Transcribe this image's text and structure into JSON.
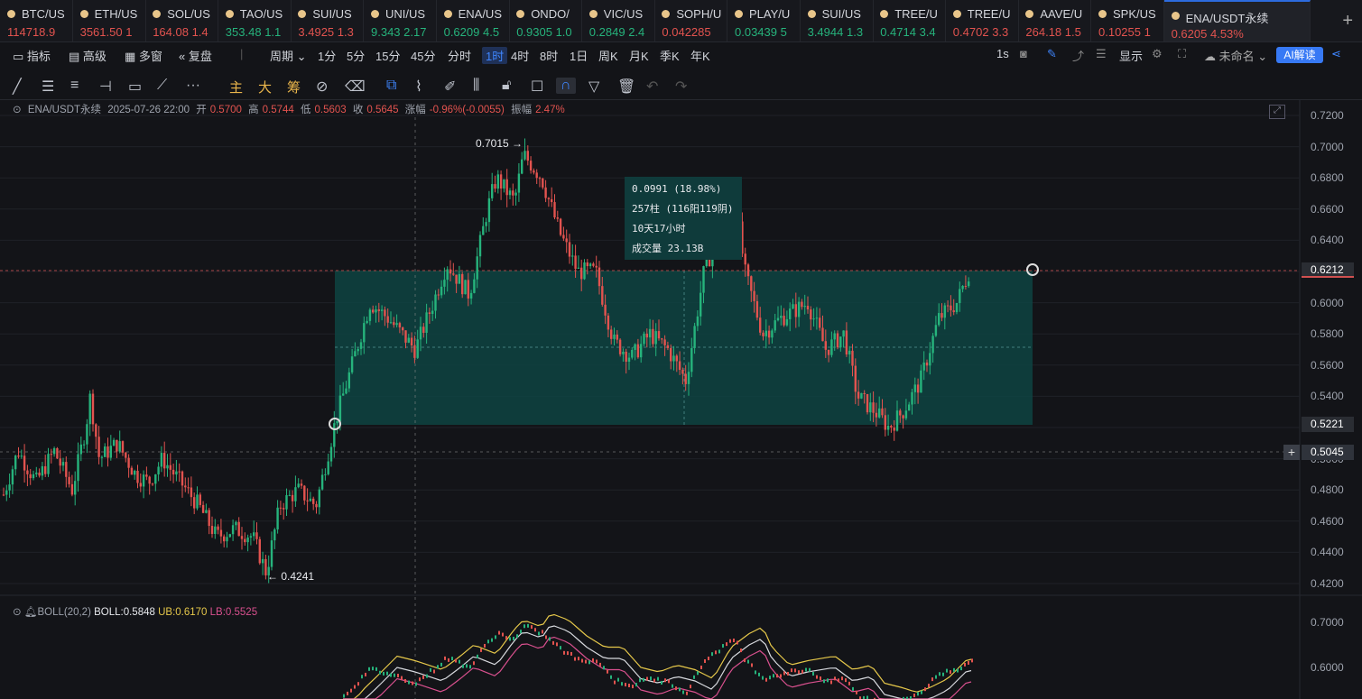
{
  "tickers": [
    {
      "symbol": "BTC/US",
      "price": "114718.9",
      "chg": "",
      "dir": "dn"
    },
    {
      "symbol": "ETH/US",
      "price": "3561.50",
      "chg": "1",
      "dir": "dn"
    },
    {
      "symbol": "SOL/US",
      "price": "164.08",
      "chg": "1.4",
      "dir": "dn"
    },
    {
      "symbol": "TAO/US",
      "price": "353.48",
      "chg": "1.1",
      "dir": "up"
    },
    {
      "symbol": "SUI/US",
      "price": "3.4925",
      "chg": "1.3",
      "dir": "dn"
    },
    {
      "symbol": "UNI/US",
      "price": "9.343",
      "chg": "2.17",
      "dir": "up"
    },
    {
      "symbol": "ENA/US",
      "price": "0.6209",
      "chg": "4.5",
      "dir": "up"
    },
    {
      "symbol": "ONDO/",
      "price": "0.9305",
      "chg": "1.0",
      "dir": "up"
    },
    {
      "symbol": "VIC/US",
      "price": "0.2849",
      "chg": "2.4",
      "dir": "up"
    },
    {
      "symbol": "SOPH/U",
      "price": "0.042285",
      "chg": "",
      "dir": "dn"
    },
    {
      "symbol": "PLAY/U",
      "price": "0.03439",
      "chg": "5",
      "dir": "up"
    },
    {
      "symbol": "SUI/US",
      "price": "3.4944",
      "chg": "1.3",
      "dir": "up"
    },
    {
      "symbol": "TREE/U",
      "price": "0.4714",
      "chg": "3.4",
      "dir": "up"
    },
    {
      "symbol": "TREE/U",
      "price": "0.4702",
      "chg": "3.3",
      "dir": "dn"
    },
    {
      "symbol": "AAVE/U",
      "price": "264.18",
      "chg": "1.5",
      "dir": "dn"
    },
    {
      "symbol": "SPK/US",
      "price": "0.10255",
      "chg": "1",
      "dir": "dn"
    },
    {
      "symbol": "ENA/USDT永续",
      "price": "0.6205",
      "chg": "4.53%",
      "dir": "dn",
      "active": true
    }
  ],
  "toolbar1": {
    "indicators": "指标",
    "advanced": "高级",
    "multiwindow": "多窗",
    "replay": "复盘",
    "period": "周期",
    "intervals": [
      "1分",
      "5分",
      "15分",
      "45分",
      "分时",
      "1时",
      "4时",
      "8时",
      "1日",
      "周K",
      "月K",
      "季K",
      "年K"
    ],
    "selected_interval": "1时",
    "right_interval": "1s",
    "display": "显示",
    "layout_name": "未命名",
    "ai_button": "AI解读"
  },
  "toolbar2": {
    "main": "主",
    "big": "大",
    "chips": "筹"
  },
  "info": {
    "symbol": "ENA/USDT永续",
    "datetime": "2025-07-26 22:00",
    "open_label": "开",
    "open": "0.5700",
    "high_label": "高",
    "high": "0.5744",
    "low_label": "低",
    "low": "0.5603",
    "close_label": "收",
    "close": "0.5645",
    "change_label": "涨幅",
    "change": "-0.96%(-0.0055)",
    "amp_label": "振幅",
    "amp": "2.47%"
  },
  "boll": {
    "label": "BOLL(20,2)",
    "mid": "BOLL:0.5848",
    "ub": "UB:0.6170",
    "lb": "LB:0.5525"
  },
  "measure": {
    "line1": "0.0991 (18.98%)",
    "line2": "257柱 (116阳119阴)",
    "line3": "10天17小时",
    "line4": "成交量 23.13B"
  },
  "annotations": {
    "high": "0.7015",
    "low": "0.4241"
  },
  "price_tags": {
    "current": "0.6212",
    "range_low": "0.5221",
    "crosshair": "0.5045"
  },
  "chart_data": {
    "type": "candlestick",
    "ylim": [
      0.41,
      0.725
    ],
    "yticks": [
      "0.7200",
      "0.7000",
      "0.6800",
      "0.6600",
      "0.6400",
      "0.6200",
      "0.6000",
      "0.5800",
      "0.5600",
      "0.5400",
      "0.5200",
      "0.5000",
      "0.4800",
      "0.4600",
      "0.4400",
      "0.4200"
    ],
    "boll_yticks": [
      "0.7000",
      "0.6000"
    ],
    "path": [
      [
        0,
        0.47
      ],
      [
        20,
        0.505
      ],
      [
        40,
        0.485
      ],
      [
        60,
        0.505
      ],
      [
        80,
        0.48
      ],
      [
        95,
        0.52
      ],
      [
        100,
        0.54
      ],
      [
        110,
        0.5
      ],
      [
        130,
        0.51
      ],
      [
        150,
        0.49
      ],
      [
        165,
        0.485
      ],
      [
        180,
        0.5
      ],
      [
        200,
        0.485
      ],
      [
        220,
        0.47
      ],
      [
        240,
        0.45
      ],
      [
        260,
        0.455
      ],
      [
        280,
        0.45
      ],
      [
        295,
        0.427
      ],
      [
        310,
        0.47
      ],
      [
        330,
        0.48
      ],
      [
        350,
        0.47
      ],
      [
        372,
        0.525
      ],
      [
        390,
        0.56
      ],
      [
        410,
        0.6
      ],
      [
        430,
        0.59
      ],
      [
        460,
        0.57
      ],
      [
        480,
        0.6
      ],
      [
        495,
        0.625
      ],
      [
        520,
        0.605
      ],
      [
        540,
        0.66
      ],
      [
        550,
        0.68
      ],
      [
        570,
        0.665
      ],
      [
        580,
        0.695
      ],
      [
        600,
        0.68
      ],
      [
        620,
        0.645
      ],
      [
        640,
        0.62
      ],
      [
        660,
        0.62
      ],
      [
        680,
        0.575
      ],
      [
        700,
        0.565
      ],
      [
        720,
        0.58
      ],
      [
        740,
        0.57
      ],
      [
        760,
        0.55
      ],
      [
        780,
        0.62
      ],
      [
        800,
        0.65
      ],
      [
        815,
        0.665
      ],
      [
        825,
        0.62
      ],
      [
        845,
        0.58
      ],
      [
        865,
        0.59
      ],
      [
        895,
        0.6
      ],
      [
        915,
        0.57
      ],
      [
        935,
        0.58
      ],
      [
        950,
        0.54
      ],
      [
        970,
        0.53
      ],
      [
        985,
        0.52
      ],
      [
        1000,
        0.53
      ],
      [
        1020,
        0.55
      ],
      [
        1040,
        0.59
      ],
      [
        1060,
        0.6
      ],
      [
        1075,
        0.622
      ]
    ]
  }
}
